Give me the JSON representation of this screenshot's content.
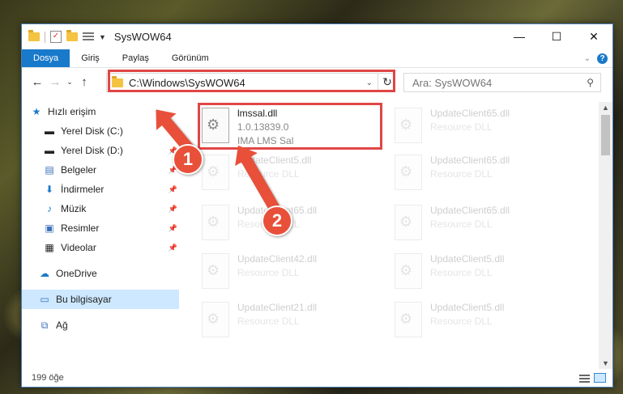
{
  "window": {
    "title": "SysWOW64",
    "controls": {
      "minimize": "—",
      "maximize": "☐",
      "close": "✕"
    }
  },
  "ribbon": {
    "tabs": [
      "Dosya",
      "Giriş",
      "Paylaş",
      "Görünüm"
    ]
  },
  "address": {
    "path": "C:\\Windows\\SysWOW64",
    "search_placeholder": "Ara: SysWOW64"
  },
  "sidebar": {
    "items": [
      {
        "label": "Hızlı erişim",
        "icon": "star-icon"
      },
      {
        "label": "Yerel Disk (C:)",
        "icon": "drive-icon"
      },
      {
        "label": "Yerel Disk (D:)",
        "icon": "drive-icon"
      },
      {
        "label": "Belgeler",
        "icon": "documents-icon"
      },
      {
        "label": "İndirmeler",
        "icon": "download-icon"
      },
      {
        "label": "Müzik",
        "icon": "music-icon"
      },
      {
        "label": "Resimler",
        "icon": "pictures-icon"
      },
      {
        "label": "Videolar",
        "icon": "video-icon"
      },
      {
        "label": "OneDrive",
        "icon": "cloud-icon"
      },
      {
        "label": "Bu bilgisayar",
        "icon": "computer-icon"
      },
      {
        "label": "Ağ",
        "icon": "network-icon"
      }
    ]
  },
  "files": [
    {
      "name": "lmssal.dll",
      "line2": "1.0.13839.0",
      "line3": "IMA LMS Sal"
    },
    {
      "name": "UpdateClient65.dll",
      "line2": "Resource DLL"
    },
    {
      "name": "UpdateClient5.dll",
      "line2": "Resource DLL"
    },
    {
      "name": "UpdateClient65.dll",
      "line2": "Resource DLL"
    },
    {
      "name": "UpdateClient65.dll",
      "line2": "Resource DLL"
    },
    {
      "name": "UpdateClient65.dll",
      "line2": "Resource DLL"
    },
    {
      "name": "UpdateClient42.dll",
      "line2": "Resource DLL"
    },
    {
      "name": "UpdateClient5.dll",
      "line2": "Resource DLL"
    },
    {
      "name": "UpdateClient21.dll",
      "line2": "Resource DLL"
    },
    {
      "name": "UpdateClient5.dll",
      "line2": "Resource DLL"
    }
  ],
  "status": {
    "count": "199 öğe"
  },
  "annotations": {
    "step1": "1",
    "step2": "2"
  },
  "colors": {
    "accent": "#1979ca",
    "highlight": "#e04646"
  }
}
